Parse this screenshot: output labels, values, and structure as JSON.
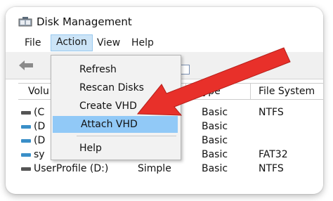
{
  "window": {
    "title": "Disk Management"
  },
  "menubar": {
    "items": [
      "File",
      "Action",
      "View",
      "Help"
    ],
    "active": "Action"
  },
  "action_menu": {
    "items": [
      "Refresh",
      "Rescan Disks",
      "Create VHD",
      "Attach VHD",
      "Help"
    ],
    "highlighted": "Attach VHD"
  },
  "table": {
    "headers": [
      "Volu",
      "ype",
      "File System"
    ],
    "rows": [
      {
        "volume": "(C",
        "type": "Basic",
        "fs": "NTFS"
      },
      {
        "volume": "(D",
        "type": "Basic",
        "fs": ""
      },
      {
        "volume": "(D",
        "type": "Basic",
        "fs": ""
      },
      {
        "volume": "sy",
        "type": "Basic",
        "fs": "FAT32"
      },
      {
        "volume": "UserProfile (D:)",
        "layout": "Simple",
        "type": "Basic",
        "fs": "NTFS"
      }
    ]
  },
  "icons": {
    "back": "back-arrow-icon",
    "app": "disk-management-icon",
    "disk": "disk-icon",
    "pointer": "red-arrow-annotation"
  },
  "colors": {
    "menu_highlight": "#91c9f7",
    "active_menu": "#cce4f7",
    "arrow": "#e8302a",
    "disk_icon": "#3a8fc8"
  }
}
